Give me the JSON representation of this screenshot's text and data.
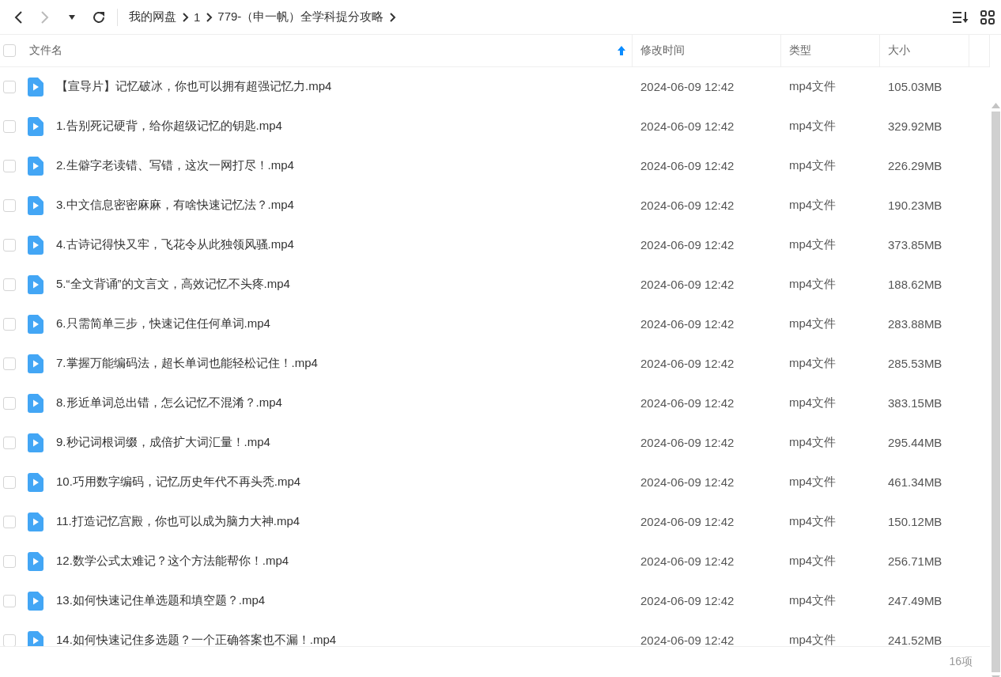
{
  "toolbar": {
    "back": {
      "disabled": false
    },
    "forward": {
      "disabled": true
    },
    "breadcrumbs": [
      "我的网盘",
      "1",
      "779-（申一帆）全学科提分攻略"
    ]
  },
  "table": {
    "select_all": {
      "checked": false
    },
    "columns": [
      {
        "label": "文件名",
        "sorted": true
      },
      {
        "label": "修改时间",
        "sorted": false
      },
      {
        "label": "类型",
        "sorted": false
      },
      {
        "label": "大小",
        "sorted": false
      }
    ],
    "rows": [
      {
        "checked": false,
        "name": "【宣导片】记忆破冰，你也可以拥有超强记忆力.mp4",
        "modified": "2024-06-09 12:42",
        "type": "mp4文件",
        "size": "105.03MB"
      },
      {
        "checked": false,
        "name": "1.告别死记硬背，给你超级记忆的钥匙.mp4",
        "modified": "2024-06-09 12:42",
        "type": "mp4文件",
        "size": "329.92MB"
      },
      {
        "checked": false,
        "name": "2.生僻字老读错、写错，这次一网打尽！.mp4",
        "modified": "2024-06-09 12:42",
        "type": "mp4文件",
        "size": "226.29MB"
      },
      {
        "checked": false,
        "name": "3.中文信息密密麻麻，有啥快速记忆法？.mp4",
        "modified": "2024-06-09 12:42",
        "type": "mp4文件",
        "size": "190.23MB"
      },
      {
        "checked": false,
        "name": "4.古诗记得快又牢，飞花令从此独领风骚.mp4",
        "modified": "2024-06-09 12:42",
        "type": "mp4文件",
        "size": "373.85MB"
      },
      {
        "checked": false,
        "name": "5.“全文背诵”的文言文，高效记忆不头疼.mp4",
        "modified": "2024-06-09 12:42",
        "type": "mp4文件",
        "size": "188.62MB"
      },
      {
        "checked": false,
        "name": "6.只需简单三步，快速记住任何单词.mp4",
        "modified": "2024-06-09 12:42",
        "type": "mp4文件",
        "size": "283.88MB"
      },
      {
        "checked": false,
        "name": "7.掌握万能编码法，超长单词也能轻松记住！.mp4",
        "modified": "2024-06-09 12:42",
        "type": "mp4文件",
        "size": "285.53MB"
      },
      {
        "checked": false,
        "name": "8.形近单词总出错，怎么记忆不混淆？.mp4",
        "modified": "2024-06-09 12:42",
        "type": "mp4文件",
        "size": "383.15MB"
      },
      {
        "checked": false,
        "name": "9.秒记词根词缀，成倍扩大词汇量！.mp4",
        "modified": "2024-06-09 12:42",
        "type": "mp4文件",
        "size": "295.44MB"
      },
      {
        "checked": false,
        "name": "10.巧用数字编码，记忆历史年代不再头秃.mp4",
        "modified": "2024-06-09 12:42",
        "type": "mp4文件",
        "size": "461.34MB"
      },
      {
        "checked": false,
        "name": "11.打造记忆宫殿，你也可以成为脑力大神.mp4",
        "modified": "2024-06-09 12:42",
        "type": "mp4文件",
        "size": "150.12MB"
      },
      {
        "checked": false,
        "name": "12.数学公式太难记？这个方法能帮你！.mp4",
        "modified": "2024-06-09 12:42",
        "type": "mp4文件",
        "size": "256.71MB"
      },
      {
        "checked": false,
        "name": "13.如何快速记住单选题和填空题？.mp4",
        "modified": "2024-06-09 12:42",
        "type": "mp4文件",
        "size": "247.49MB"
      },
      {
        "checked": false,
        "name": "14.如何快速记住多选题？一个正确答案也不漏！.mp4",
        "modified": "2024-06-09 12:42",
        "type": "mp4文件",
        "size": "241.52MB"
      }
    ]
  },
  "status_bar": {
    "count": "16项"
  }
}
